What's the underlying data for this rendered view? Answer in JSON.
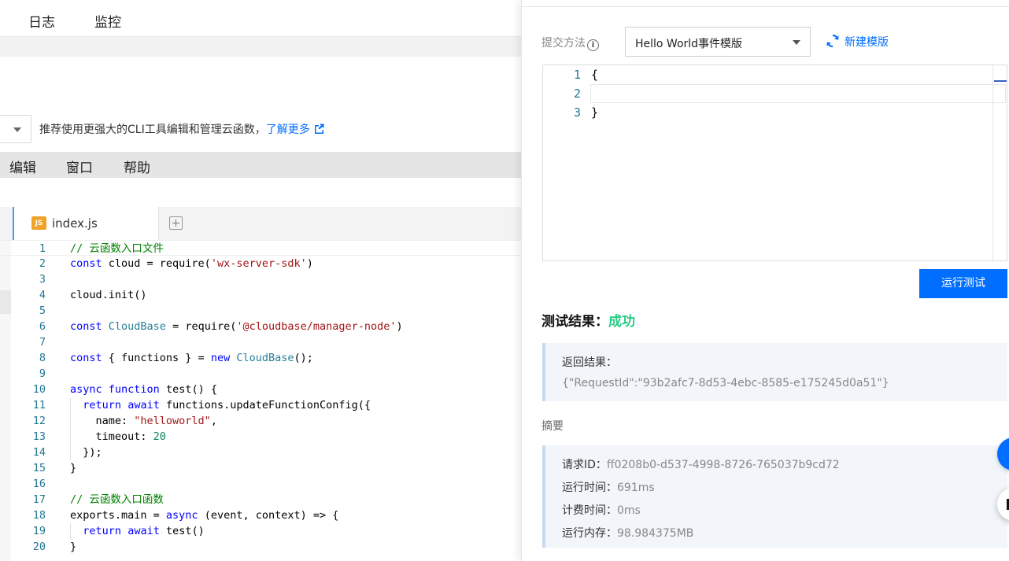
{
  "top_nav": {
    "tabs": [
      "日志",
      "监控"
    ]
  },
  "tip": {
    "text": "推荐使用更强大的CLI工具编辑和管理云函数，",
    "link": "了解更多"
  },
  "menu": {
    "items": [
      "编辑",
      "窗口",
      "帮助"
    ]
  },
  "file_tab": {
    "icon_text": "JS",
    "name": "index.js"
  },
  "code": {
    "lines": [
      [
        {
          "c": "cm",
          "t": "// 云函数入口文件"
        }
      ],
      [
        {
          "c": "kw",
          "t": "const"
        },
        {
          "c": "",
          "t": " cloud = require("
        },
        {
          "c": "str",
          "t": "'wx-server-sdk'"
        },
        {
          "c": "",
          "t": ")"
        }
      ],
      [],
      [
        {
          "c": "",
          "t": "cloud.init()"
        }
      ],
      [],
      [
        {
          "c": "kw",
          "t": "const"
        },
        {
          "c": "",
          "t": " "
        },
        {
          "c": "ty",
          "t": "CloudBase"
        },
        {
          "c": "",
          "t": " = require("
        },
        {
          "c": "str",
          "t": "'@cloudbase/manager-node'"
        },
        {
          "c": "",
          "t": ")"
        }
      ],
      [],
      [
        {
          "c": "kw",
          "t": "const"
        },
        {
          "c": "",
          "t": " { functions } = "
        },
        {
          "c": "kw",
          "t": "new"
        },
        {
          "c": "",
          "t": " "
        },
        {
          "c": "ty",
          "t": "CloudBase"
        },
        {
          "c": "",
          "t": "();"
        }
      ],
      [],
      [
        {
          "c": "kw",
          "t": "async"
        },
        {
          "c": "",
          "t": " "
        },
        {
          "c": "kw",
          "t": "function"
        },
        {
          "c": "",
          "t": " test() {"
        }
      ],
      [
        {
          "c": "",
          "t": "  "
        },
        {
          "c": "kw",
          "t": "return"
        },
        {
          "c": "",
          "t": " "
        },
        {
          "c": "kw",
          "t": "await"
        },
        {
          "c": "",
          "t": " functions.updateFunctionConfig({"
        }
      ],
      [
        {
          "c": "",
          "t": "    name: "
        },
        {
          "c": "str",
          "t": "\"helloworld\""
        },
        {
          "c": "",
          "t": ","
        }
      ],
      [
        {
          "c": "",
          "t": "    timeout: "
        },
        {
          "c": "num",
          "t": "20"
        }
      ],
      [
        {
          "c": "",
          "t": "  });"
        }
      ],
      [
        {
          "c": "",
          "t": "}"
        }
      ],
      [],
      [
        {
          "c": "cm",
          "t": "// 云函数入口函数"
        }
      ],
      [
        {
          "c": "",
          "t": "exports.main = "
        },
        {
          "c": "kw",
          "t": "async"
        },
        {
          "c": "",
          "t": " (event, context) => {"
        }
      ],
      [
        {
          "c": "",
          "t": "  "
        },
        {
          "c": "kw",
          "t": "return"
        },
        {
          "c": "",
          "t": " "
        },
        {
          "c": "kw",
          "t": "await"
        },
        {
          "c": "",
          "t": " test()"
        }
      ],
      [
        {
          "c": "",
          "t": "}"
        }
      ]
    ]
  },
  "test_panel": {
    "method_label": "提交方法",
    "template_selected": "Hello World事件模版",
    "new_template_link": "新建模版",
    "json_lines": [
      "{",
      "",
      "}"
    ],
    "run_button": "运行测试",
    "result_label": "测试结果：",
    "result_status": "成功",
    "return_label": "返回结果：",
    "return_value": "{\"RequestId\":\"93b2afc7-8d53-4ebc-8585-e175245d0a51\"}",
    "summary_label": "摘要",
    "summary": [
      {
        "key": "请求ID：",
        "value": "ff0208b0-d537-4998-8726-765037b9cd72"
      },
      {
        "key": "运行时间：",
        "value": "691ms"
      },
      {
        "key": "计费时间：",
        "value": "0ms"
      },
      {
        "key": "运行内存：",
        "value": "98.984375MB"
      }
    ]
  },
  "colors": {
    "accent": "#006eff",
    "success": "#29cc85",
    "js_icon": "#f0a32b"
  },
  "icons": [
    "caret-down-icon",
    "external-link-icon",
    "js-file-icon",
    "new-tab-icon",
    "info-icon",
    "refresh-icon"
  ]
}
